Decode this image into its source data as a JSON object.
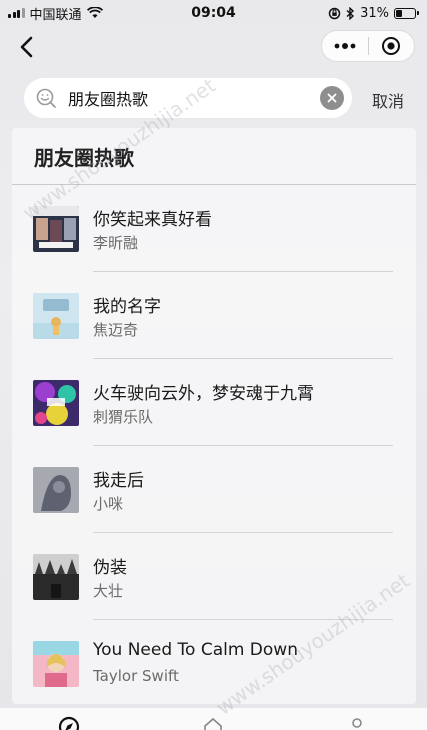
{
  "status_bar": {
    "carrier": "中国联通",
    "time": "09:04",
    "battery": "31%",
    "battery_level": 0.31
  },
  "nav": {
    "back_icon": "chevron-left-icon",
    "more_icon": "more-dots-icon",
    "close_icon": "target-circle-icon"
  },
  "search": {
    "value": "朋友圈热歌",
    "cancel_label": "取消"
  },
  "section": {
    "title": "朋友圈热歌"
  },
  "songs": [
    {
      "title": "你笑起来真好看",
      "artist": "李昕融"
    },
    {
      "title": "我的名字",
      "artist": "焦迈奇"
    },
    {
      "title": "火车驶向云外，梦安魂于九霄",
      "artist": "刺猬乐队"
    },
    {
      "title": "我走后",
      "artist": "小咪"
    },
    {
      "title": "伪装",
      "artist": "大壮"
    },
    {
      "title": "You Need To Calm Down",
      "artist": "Taylor Swift"
    }
  ],
  "watermark": "www.shouyouzhijia.net",
  "colors": {
    "background": "#ebebee",
    "text": "#1a1a1a",
    "secondary_text": "#6b6b6b",
    "accent": "#1aad19"
  }
}
